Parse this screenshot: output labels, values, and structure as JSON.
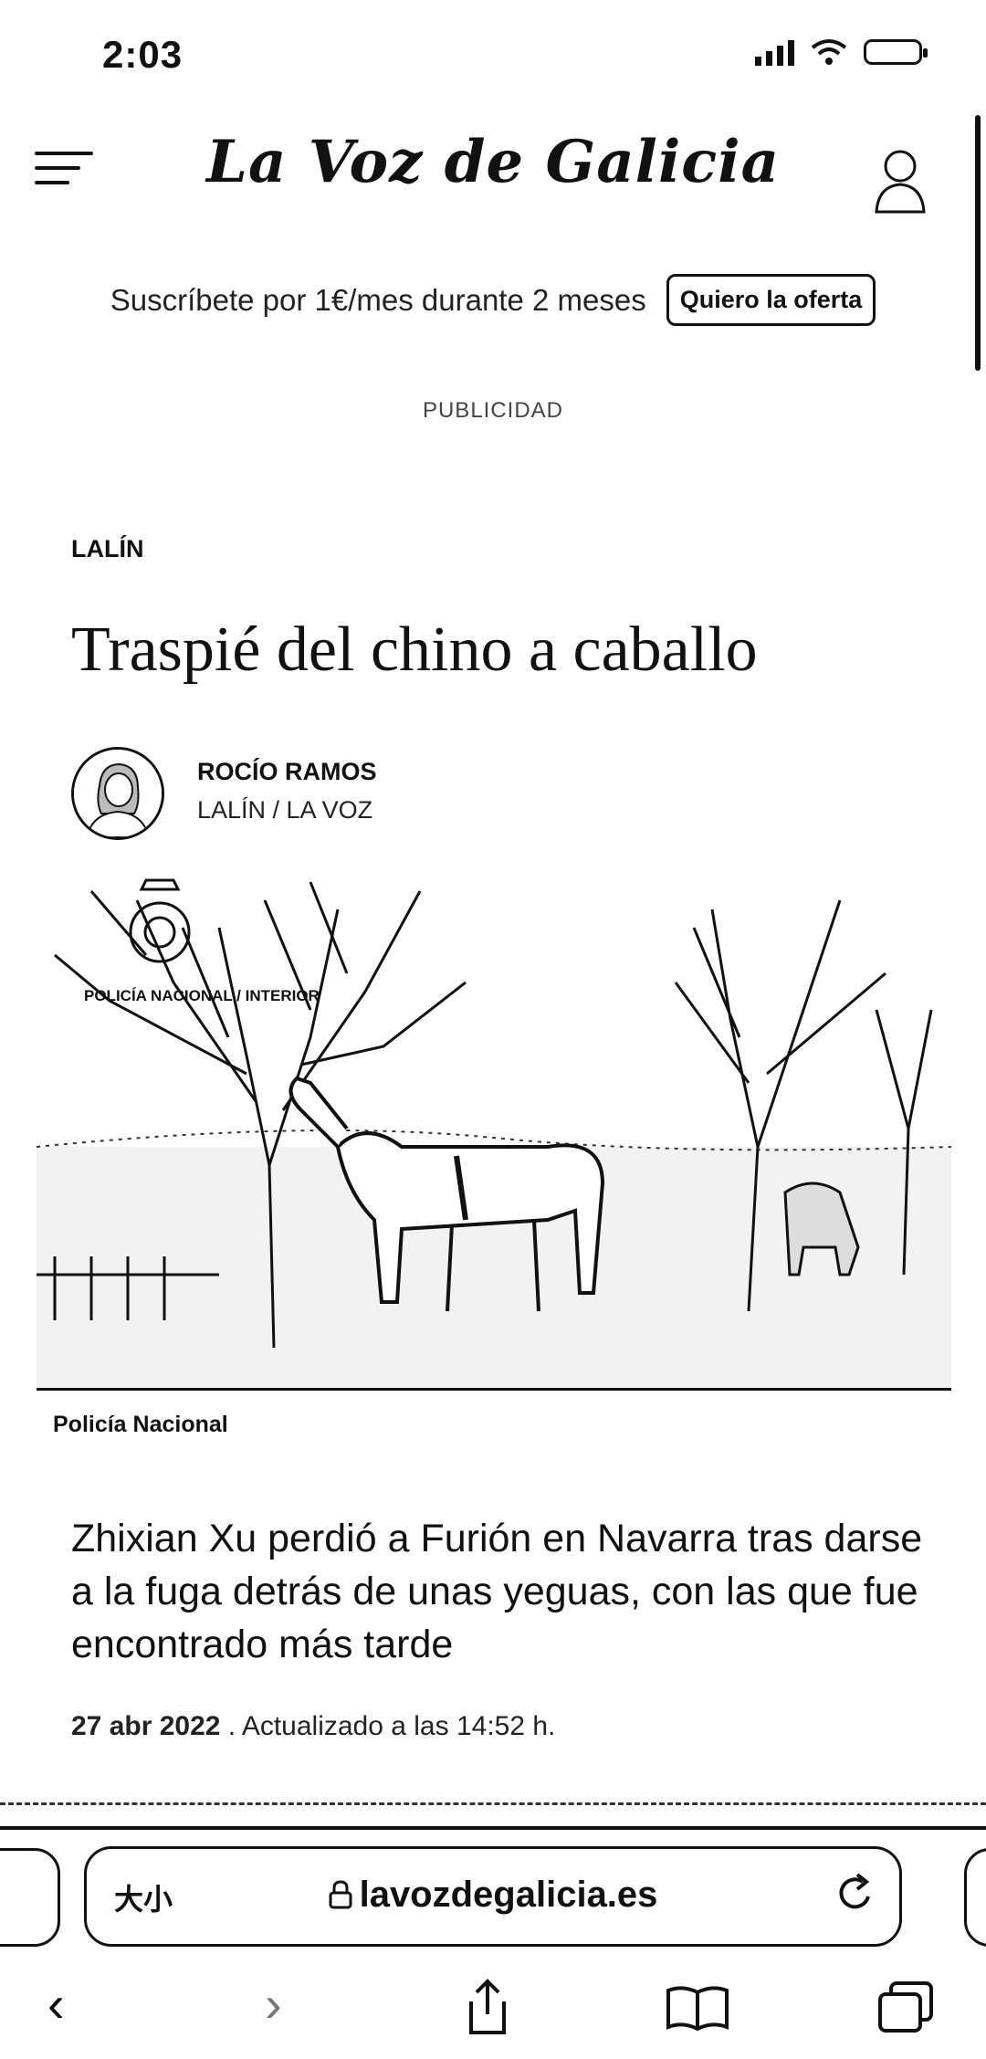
{
  "status_bar": {
    "time": "2:03"
  },
  "header": {
    "logo": "La Voz de Galicia"
  },
  "promo": {
    "text": "Suscríbete por 1€/mes durante 2 meses",
    "button": "Quiero la oferta"
  },
  "ad_label": "PUBLICIDAD",
  "article": {
    "section": "LALÍN",
    "headline": "Traspié del chino a caballo",
    "author_name": "ROCÍO RAMOS",
    "author_location": "LALÍN / LA VOZ",
    "photo_watermark": "POLICÍA NACIONAL / INTERIOR",
    "photo_caption": "Policía Nacional",
    "summary": "Zhixian Xu perdió a Furión en Navarra tras darse a la fuga detrás de unas yeguas, con las que fue encontrado más tarde",
    "date": "27 abr 2022",
    "updated": " . Actualizado a las 14:52 h."
  },
  "browser": {
    "text_size_label": "大小",
    "url": "lavozdegalicia.es",
    "lock_icon": "lock-icon",
    "nav": {
      "back": "‹",
      "forward": "›"
    }
  }
}
